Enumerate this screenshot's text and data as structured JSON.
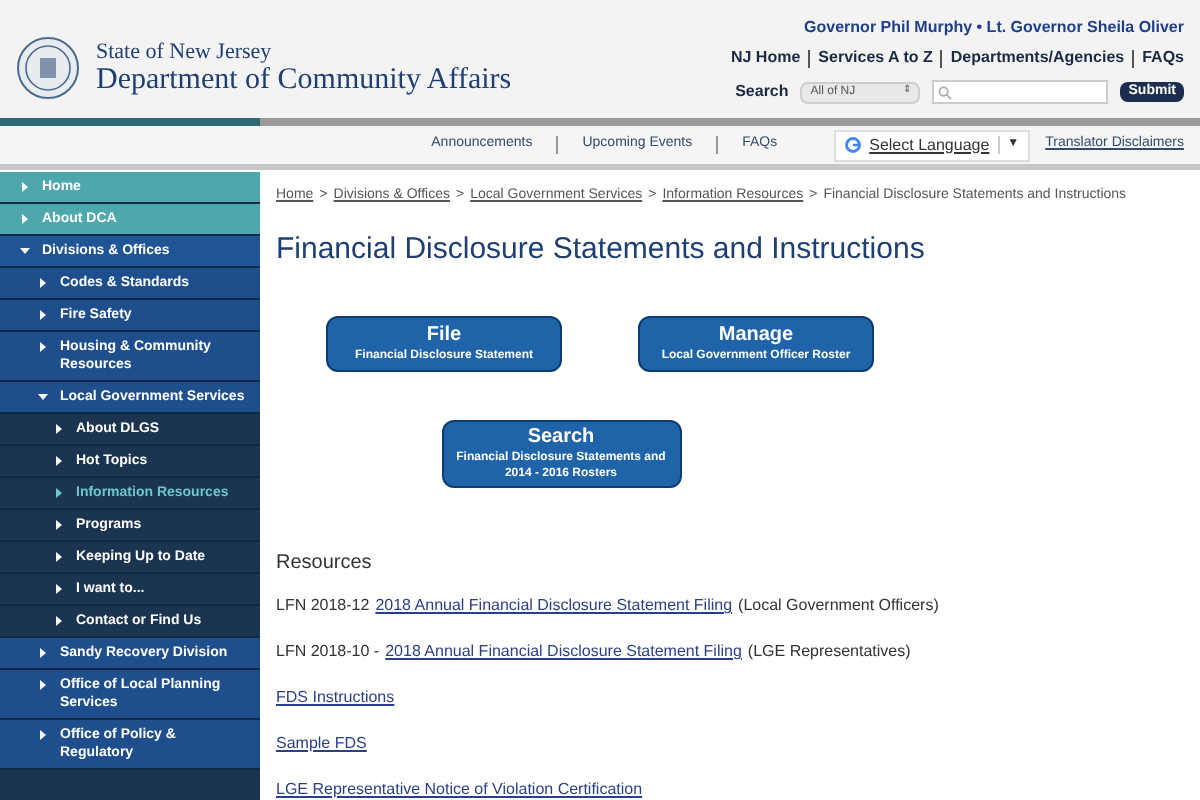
{
  "header": {
    "state_line": "State of New Jersey",
    "department": "Department of Community Affairs",
    "officials": "Governor Phil Murphy • Lt. Governor Sheila Oliver",
    "top_links": [
      "NJ Home",
      "Services A to Z",
      "Departments/Agencies",
      "FAQs"
    ],
    "search": {
      "label": "Search",
      "scope": "All of NJ",
      "scope_arrow": "⇕",
      "button": "Submit"
    }
  },
  "nav": {
    "links": [
      "Announcements",
      "Upcoming Events",
      "FAQs"
    ],
    "language": "Select Language",
    "language_arrow": "▼",
    "translator": "Translator Disclaimers"
  },
  "sidebar": {
    "items": [
      {
        "label": "Home",
        "kind": "highlight",
        "expanded": false,
        "selected": false
      },
      {
        "label": "About DCA",
        "kind": "highlight",
        "expanded": false,
        "selected": false
      },
      {
        "label": "Divisions & Offices",
        "kind": "section",
        "expanded": true,
        "selected": false,
        "children": [
          {
            "label": "Codes & Standards",
            "expanded": false,
            "selected": false
          },
          {
            "label": "Fire Safety",
            "expanded": false,
            "selected": false
          },
          {
            "label": "Housing & Community Resources",
            "expanded": false,
            "selected": false
          },
          {
            "label": "Local Government Services",
            "expanded": true,
            "selected": false,
            "children": [
              {
                "label": "About DLGS",
                "expanded": false,
                "selected": false
              },
              {
                "label": "Hot Topics",
                "expanded": false,
                "selected": false
              },
              {
                "label": "Information Resources",
                "expanded": false,
                "selected": true
              },
              {
                "label": "Programs",
                "expanded": false,
                "selected": false
              },
              {
                "label": "Keeping Up to Date",
                "expanded": false,
                "selected": false
              },
              {
                "label": "I want to...",
                "expanded": false,
                "selected": false
              },
              {
                "label": "Contact or Find Us",
                "expanded": false,
                "selected": false
              }
            ]
          },
          {
            "label": "Sandy Recovery Division",
            "expanded": false,
            "selected": false
          },
          {
            "label": "Office of Local Planning Services",
            "expanded": false,
            "selected": false
          },
          {
            "label": "Office of Policy & Regulatory",
            "expanded": false,
            "selected": false
          }
        ]
      }
    ]
  },
  "breadcrumb": {
    "separator": ">",
    "links": [
      "Home",
      "Divisions & Offices",
      "Local Government Services",
      "Information Resources"
    ],
    "current": "Financial Disclosure Statements and Instructions"
  },
  "title": "Financial Disclosure Statements and Instructions",
  "action_buttons": [
    {
      "title": "File",
      "subtitle": "Financial Disclosure Statement"
    },
    {
      "title": "Manage",
      "subtitle": "Local Government Officer Roster"
    },
    {
      "title": "Search",
      "subtitle": "Financial Disclosure Statements and 2014 - 2016 Rosters"
    }
  ],
  "resources": {
    "heading": "Resources",
    "items": [
      {
        "prefix": "LFN 2018-12",
        "link": "2018 Annual Financial Disclosure Statement Filing",
        "suffix": "(Local Government Officers)"
      },
      {
        "prefix": "LFN 2018-10 -",
        "link": "2018 Annual Financial Disclosure Statement Filing",
        "suffix": "(LGE Representatives)"
      },
      {
        "link": "FDS Instructions"
      },
      {
        "link": "Sample FDS"
      },
      {
        "link": "LGE Representative Notice of Violation Certification"
      }
    ]
  }
}
